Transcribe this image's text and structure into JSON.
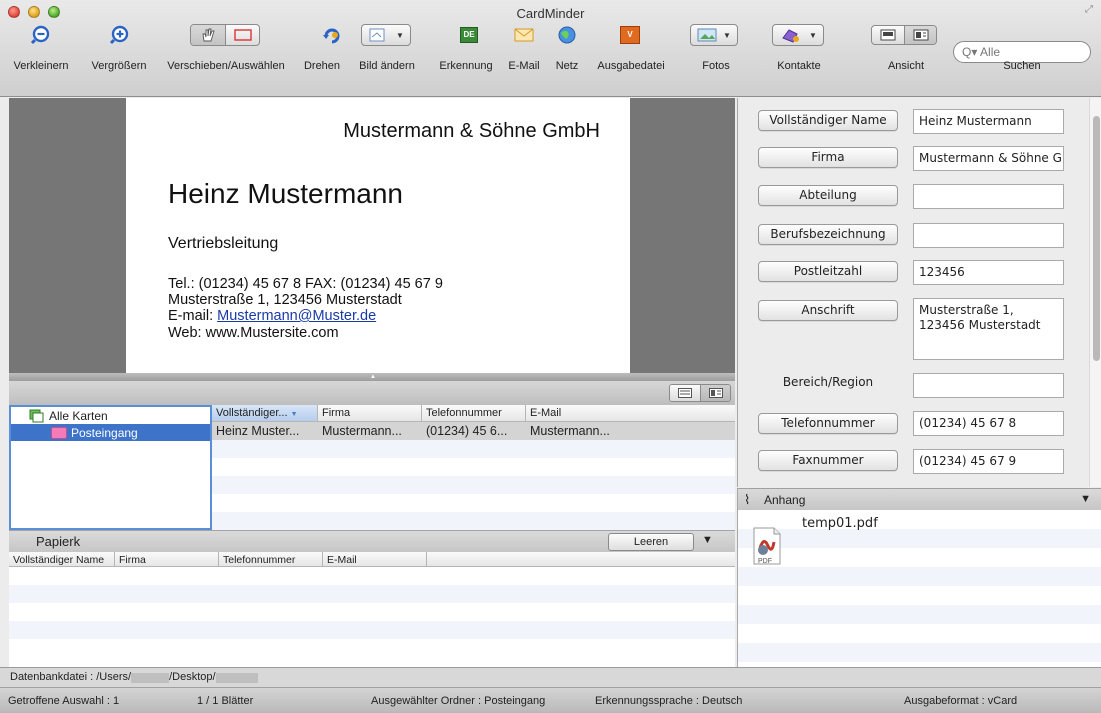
{
  "window": {
    "title": "CardMinder"
  },
  "toolbar": {
    "items": [
      {
        "label": "Verkleinern",
        "icon": "zoom-out-icon"
      },
      {
        "label": "Vergrößern",
        "icon": "zoom-in-icon"
      },
      {
        "label": "Verschieben/Auswählen",
        "icon": "hand-select-icon"
      },
      {
        "label": "Drehen",
        "icon": "rotate-icon"
      },
      {
        "label": "Bild ändern",
        "icon": "edit-image-icon"
      },
      {
        "label": "Erkennung",
        "icon": "recognition-icon"
      },
      {
        "label": "E-Mail",
        "icon": "envelope-icon"
      },
      {
        "label": "Netz",
        "icon": "globe-icon"
      },
      {
        "label": "Ausgabedatei",
        "icon": "output-file-icon"
      },
      {
        "label": "Fotos",
        "icon": "photos-icon"
      },
      {
        "label": "Kontakte",
        "icon": "contacts-icon"
      },
      {
        "label": "Ansicht",
        "icon": "view-layout-icon"
      },
      {
        "label": "Suchen",
        "icon": "search-icon"
      }
    ],
    "search_placeholder": "Alle",
    "badge_text": "DE"
  },
  "card_image": {
    "company": "Mustermann & Söhne GmbH",
    "person": "Heinz Mustermann",
    "role": "Vertriebsleitung",
    "phone_line": "Tel.: (01234) 45 67 8 FAX: (01234) 45 67 9",
    "address_line": "Musterstraße 1, 123456 Musterstadt",
    "email_prefix": "E-mail: ",
    "email": "Mustermann@Muster.de",
    "web_line": "Web: www.Mustersite.com"
  },
  "folders": [
    {
      "label": "Alle Karten",
      "selected": false
    },
    {
      "label": "Posteingang",
      "selected": true
    }
  ],
  "card_list": {
    "columns": [
      "Vollständiger...",
      "Firma",
      "Telefonnummer",
      "E-Mail"
    ],
    "rows": [
      {
        "name": "Heinz Muster...",
        "company": "Mustermann...",
        "phone": "(01234) 45 6...",
        "email": "Mustermann..."
      }
    ]
  },
  "trash": {
    "title": "Papierk",
    "empty_button": "Leeren",
    "columns": [
      "Vollständiger Name",
      "Firma",
      "Telefonnummer",
      "E-Mail"
    ]
  },
  "fields": [
    {
      "label": "Vollständiger Name",
      "value": "Heinz Mustermann",
      "button": true
    },
    {
      "label": "Firma",
      "value": "Mustermann & Söhne G",
      "button": true
    },
    {
      "label": "Abteilung",
      "value": "",
      "button": true
    },
    {
      "label": "Berufsbezeichnung",
      "value": "",
      "button": true
    },
    {
      "label": "Postleitzahl",
      "value": "123456",
      "button": true
    },
    {
      "label": "Anschrift",
      "value": "Musterstraße 1,\n123456 Musterstadt",
      "button": true
    },
    {
      "label": "Bereich/Region",
      "value": "",
      "button": false
    },
    {
      "label": "Telefonnummer",
      "value": "(01234) 45 67 8",
      "button": true
    },
    {
      "label": "Faxnummer",
      "value": "(01234) 45 67 9",
      "button": true
    }
  ],
  "attachments": {
    "title": "Anhang",
    "files": [
      {
        "name": "temp01.pdf",
        "type": "PDF"
      }
    ]
  },
  "path": {
    "prefix": "Datenbankdatei : /Users/",
    "middle": "/Desktop/"
  },
  "status": {
    "selection": "Getroffene Auswahl : 1",
    "sheets": "1 / 1 Blätter",
    "folder": "Ausgewählter Ordner : Posteingang",
    "language": "Erkennungssprache : Deutsch",
    "format": "Ausgabeformat : vCard"
  },
  "colors": {
    "selection": "#3d73c8",
    "folder_pink": "#f47ab8",
    "accent_orange": "#e06a1e"
  }
}
